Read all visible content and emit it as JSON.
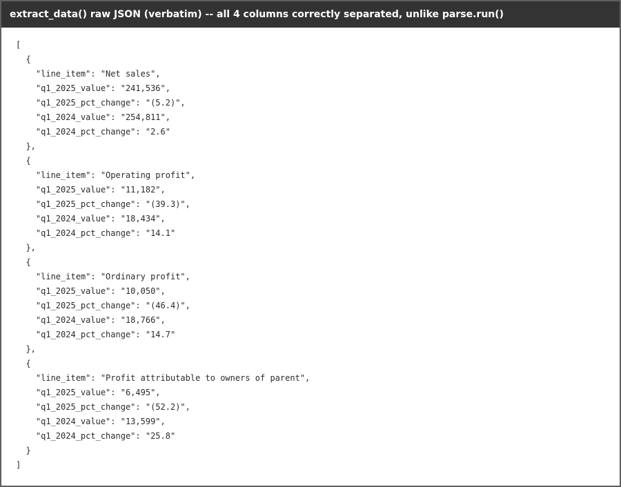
{
  "window": {
    "title": "extract_data() raw JSON (verbatim) -- all 4 columns correctly separated, unlike parse.run()"
  },
  "output": {
    "lines": [
      "[",
      "  {",
      "    \"line_item\": \"Net sales\",",
      "    \"q1_2025_value\": \"241,536\",",
      "    \"q1_2025_pct_change\": \"(5.2)\",",
      "    \"q1_2024_value\": \"254,811\",",
      "    \"q1_2024_pct_change\": \"2.6\"",
      "  },",
      "  {",
      "    \"line_item\": \"Operating profit\",",
      "    \"q1_2025_value\": \"11,182\",",
      "    \"q1_2025_pct_change\": \"(39.3)\",",
      "    \"q1_2024_value\": \"18,434\",",
      "    \"q1_2024_pct_change\": \"14.1\"",
      "  },",
      "  {",
      "    \"line_item\": \"Ordinary profit\",",
      "    \"q1_2025_value\": \"10,050\",",
      "    \"q1_2025_pct_change\": \"(46.4)\",",
      "    \"q1_2024_value\": \"18,766\",",
      "    \"q1_2024_pct_change\": \"14.7\"",
      "  },",
      "  {",
      "    \"line_item\": \"Profit attributable to owners of parent\",",
      "    \"q1_2025_value\": \"6,495\",",
      "    \"q1_2025_pct_change\": \"(52.2)\",",
      "    \"q1_2024_value\": \"13,599\",",
      "    \"q1_2024_pct_change\": \"25.8\"",
      "  }",
      "]"
    ]
  }
}
